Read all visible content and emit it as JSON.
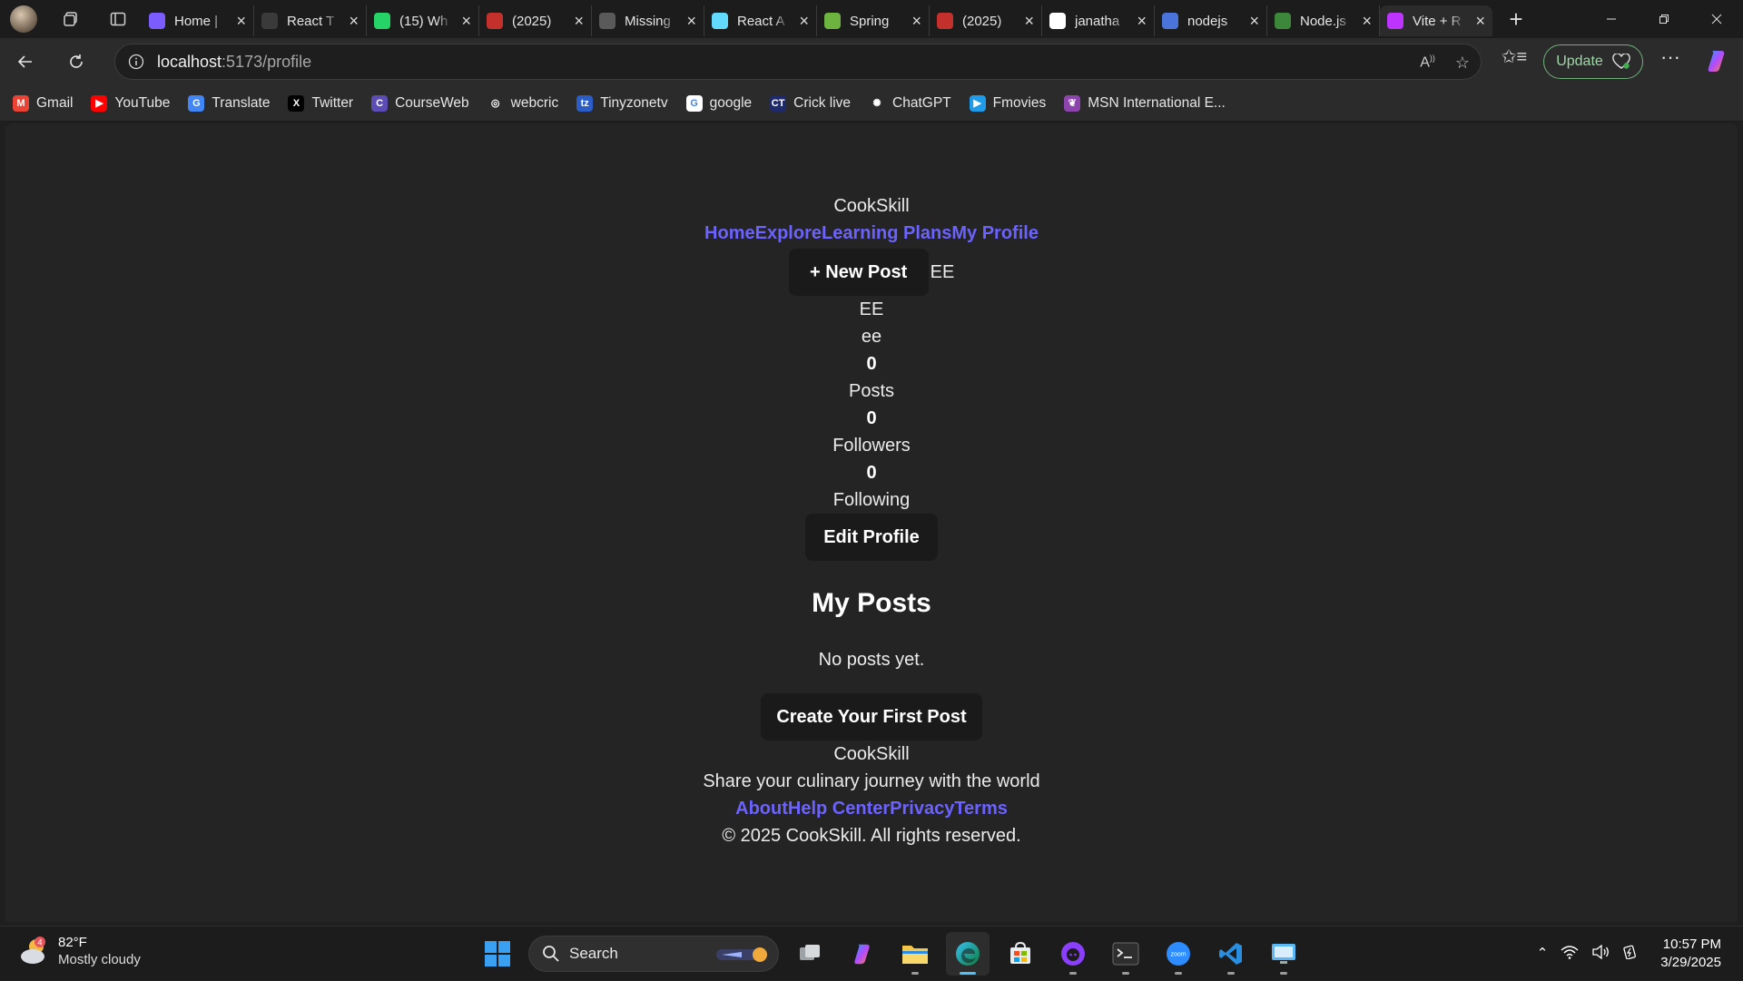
{
  "browser": {
    "tabs": [
      {
        "title": "Home |",
        "icon": "copilot-icon",
        "color": "#7a5cff"
      },
      {
        "title": "React T",
        "icon": "react-tab-icon",
        "color": "#3a3a3a"
      },
      {
        "title": "(15) Wh",
        "icon": "whatsapp-icon",
        "color": "#25d366"
      },
      {
        "title": "(2025) ",
        "icon": "youtube-icon",
        "color": "#c4302b"
      },
      {
        "title": "Missing",
        "icon": "chatgpt-icon",
        "color": "#5a5a5a"
      },
      {
        "title": "React A",
        "icon": "react-icon",
        "color": "#61dafb"
      },
      {
        "title": "Spring ",
        "icon": "spring-icon",
        "color": "#6db33f"
      },
      {
        "title": "(2025) ",
        "icon": "youtube-icon",
        "color": "#c4302b"
      },
      {
        "title": "janatha",
        "icon": "github-icon",
        "color": "#ffffff"
      },
      {
        "title": "nodejs ",
        "icon": "search-icon",
        "color": "#4a74d9"
      },
      {
        "title": "Node.js",
        "icon": "nodejs-icon",
        "color": "#3c873a"
      },
      {
        "title": "Vite + R",
        "icon": "vite-icon",
        "color": "#bd34fe"
      }
    ],
    "url_host": "localhost",
    "url_path": ":5173/profile",
    "update_label": "Update",
    "bookmarks": [
      {
        "label": "Gmail",
        "icon": "gmail-icon",
        "color": "#ea4335",
        "glyph": "M"
      },
      {
        "label": "YouTube",
        "icon": "youtube-icon",
        "color": "#ff0000",
        "glyph": "▶"
      },
      {
        "label": "Translate",
        "icon": "translate-icon",
        "color": "#4285f4",
        "glyph": "G"
      },
      {
        "label": "Twitter",
        "icon": "x-icon",
        "color": "#000000",
        "glyph": "X"
      },
      {
        "label": "CourseWeb",
        "icon": "courseweb-icon",
        "color": "#5b4db5",
        "glyph": "C"
      },
      {
        "label": "webcric",
        "icon": "globe-icon",
        "color": "#2b2b2b",
        "glyph": "◎"
      },
      {
        "label": "Tinyzonetv",
        "icon": "tinyzone-icon",
        "color": "#2c5cc5",
        "glyph": "tz"
      },
      {
        "label": "google",
        "icon": "google-icon",
        "color": "#ffffff",
        "glyph": "G"
      },
      {
        "label": "Crick live",
        "icon": "crick-icon",
        "color": "#1f2a6b",
        "glyph": "CT"
      },
      {
        "label": "ChatGPT",
        "icon": "chatgpt-icon",
        "color": "#2b2b2b",
        "glyph": "✺"
      },
      {
        "label": "Fmovies",
        "icon": "fmovies-icon",
        "color": "#1e9be9",
        "glyph": "▶"
      },
      {
        "label": "MSN International E...",
        "icon": "msn-icon",
        "color": "#8e44ad",
        "glyph": "❦"
      }
    ]
  },
  "page": {
    "brand": "CookSkill",
    "nav_links": [
      "Home",
      "Explore",
      "Learning Plans",
      "My Profile"
    ],
    "new_post_label": "+ New Post",
    "header_user": "EE",
    "display_name": "EE",
    "username": "ee",
    "stats": [
      {
        "value": "0",
        "label": "Posts"
      },
      {
        "value": "0",
        "label": "Followers"
      },
      {
        "value": "0",
        "label": "Following"
      }
    ],
    "edit_profile_label": "Edit Profile",
    "my_posts_heading": "My Posts",
    "empty_text": "No posts yet.",
    "create_first_label": "Create Your First Post",
    "footer": {
      "brand": "CookSkill",
      "tagline": "Share your culinary journey with the world",
      "links": [
        "About",
        "Help Center",
        "Privacy",
        "Terms"
      ],
      "copyright": "© 2025 CookSkill. All rights reserved."
    }
  },
  "taskbar": {
    "weather_temp": "82°F",
    "weather_desc": "Mostly cloudy",
    "weather_badge": "4",
    "search_label": "Search",
    "time": "10:57 PM",
    "date": "3/29/2025"
  }
}
